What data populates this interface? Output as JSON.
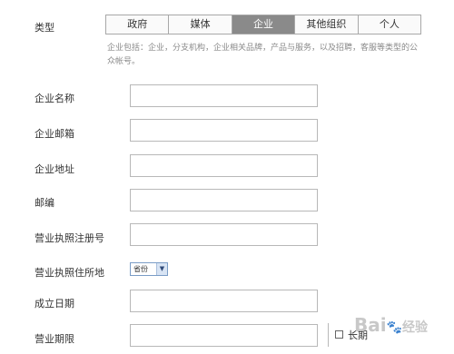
{
  "type_label": "类型",
  "tabs": [
    {
      "label": "政府",
      "active": false
    },
    {
      "label": "媒体",
      "active": false
    },
    {
      "label": "企业",
      "active": true
    },
    {
      "label": "其他组织",
      "active": false
    },
    {
      "label": "个人",
      "active": false
    }
  ],
  "hint": "企业包括：企业，分支机构，企业相关品牌，产品与服务，以及招聘，客服等类型的公众帐号。",
  "fields": [
    {
      "label": "企业名称",
      "value": ""
    },
    {
      "label": "企业邮箱",
      "value": ""
    },
    {
      "label": "企业地址",
      "value": ""
    },
    {
      "label": "邮编",
      "value": ""
    },
    {
      "label": "营业执照注册号",
      "value": ""
    }
  ],
  "address_label": "营业执照住所地",
  "province_select": "省份",
  "found_date_label": "成立日期",
  "term_label": "营业期限",
  "long_term_label": "长期",
  "watermark": {
    "text": "Bai",
    "paw": "🐾",
    "tail": "经验"
  }
}
